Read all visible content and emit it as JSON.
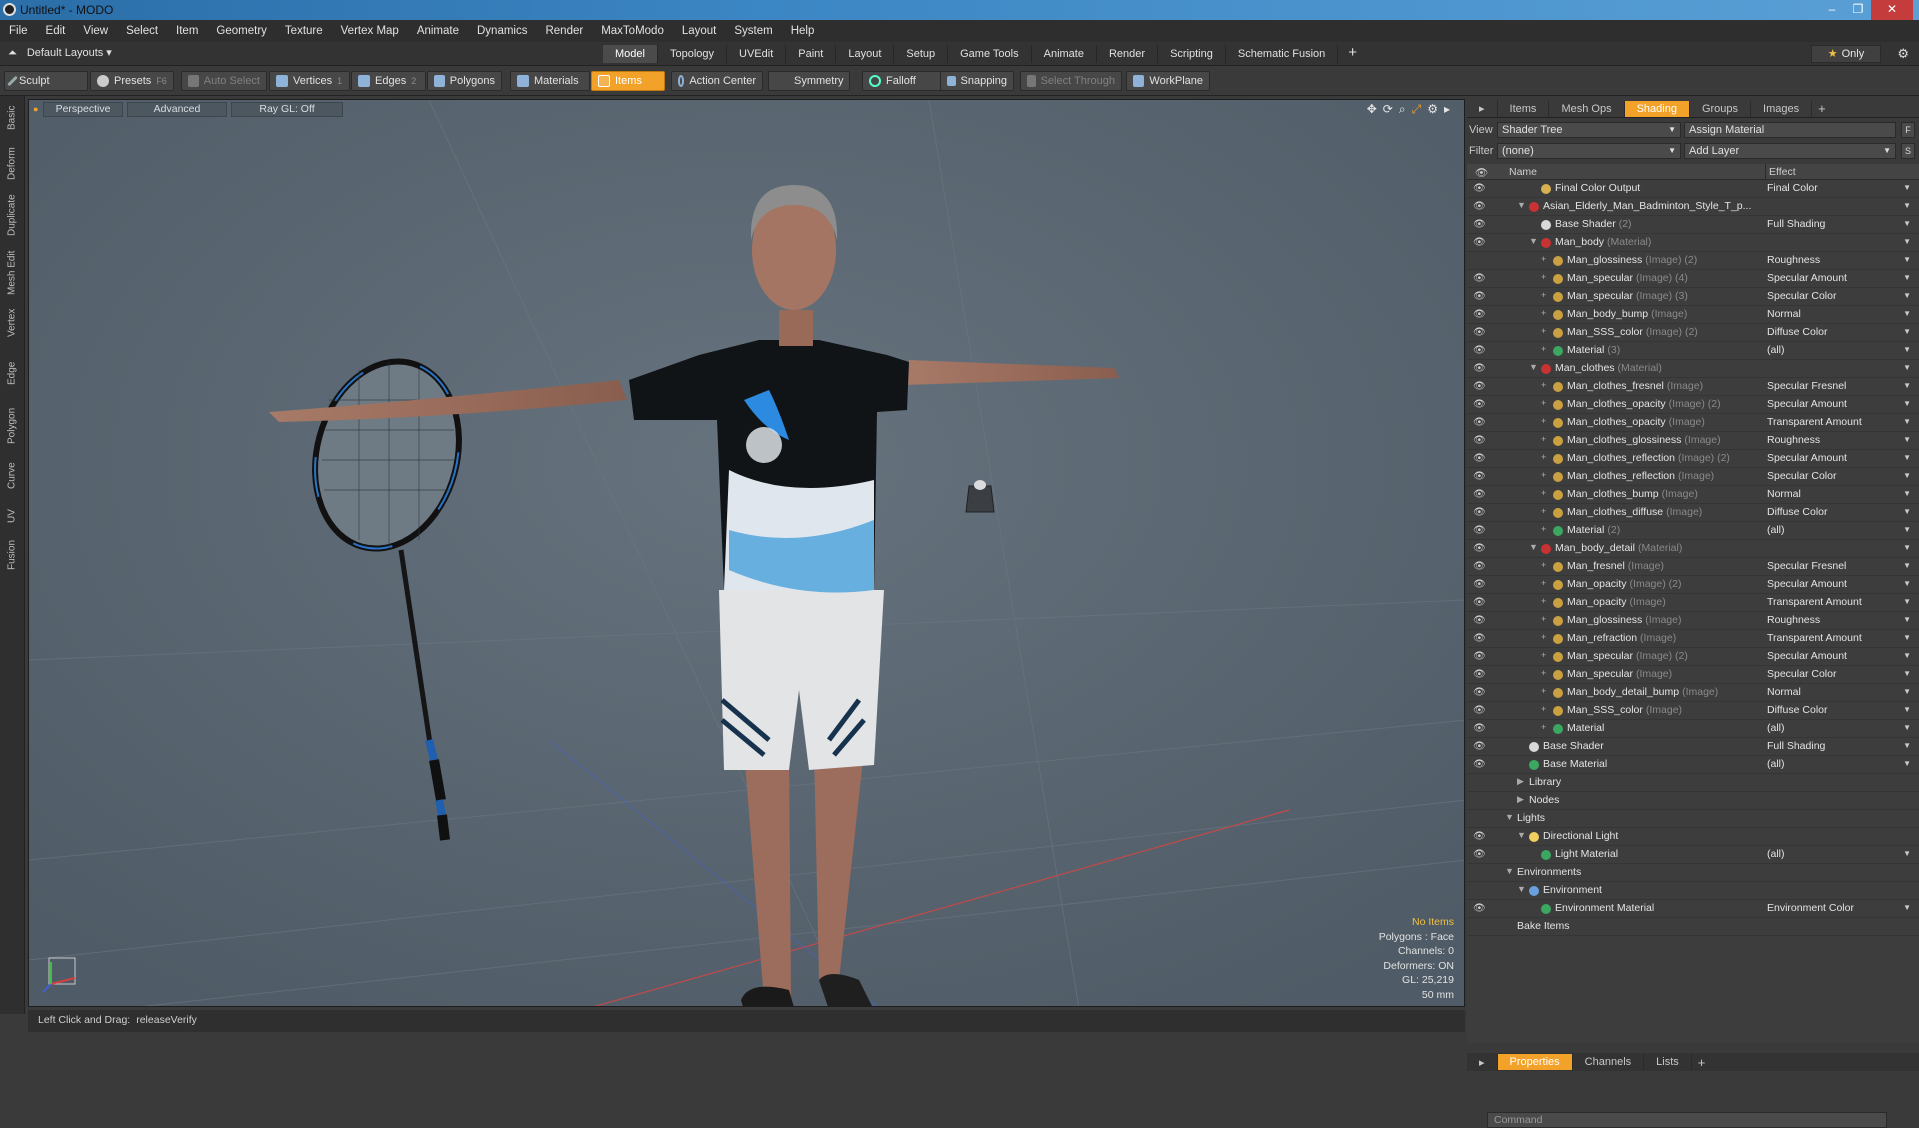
{
  "window": {
    "title": "Untitled* - MODO"
  },
  "menu": [
    "File",
    "Edit",
    "View",
    "Select",
    "Item",
    "Geometry",
    "Texture",
    "Vertex Map",
    "Animate",
    "Dynamics",
    "Render",
    "MaxToModo",
    "Layout",
    "System",
    "Help"
  ],
  "layout": {
    "current": "Default Layouts",
    "tabs": [
      "Model",
      "Topology",
      "UVEdit",
      "Paint",
      "Layout",
      "Setup",
      "Game Tools",
      "Animate",
      "Render",
      "Scripting",
      "Schematic Fusion"
    ],
    "active_tab": "Model",
    "only_label": "Only"
  },
  "toolbar": {
    "sculpt": "Sculpt",
    "presets": "Presets",
    "presets_key": "F6",
    "auto_select": "Auto Select",
    "vertices": "Vertices",
    "vertices_key": "1",
    "edges": "Edges",
    "edges_key": "2",
    "polygons": "Polygons",
    "materials": "Materials",
    "items": "Items",
    "action_center": "Action Center",
    "symmetry": "Symmetry",
    "falloff": "Falloff",
    "snapping": "Snapping",
    "select_through": "Select Through",
    "workplane": "WorkPlane"
  },
  "side_tabs": [
    "Basic",
    "Deform",
    "Duplicate",
    "Mesh Edit",
    "Vertex",
    "Edge",
    "Polygon",
    "Curve",
    "UV",
    "Fusion"
  ],
  "viewport": {
    "view": "Perspective",
    "shading": "Advanced",
    "raygl": "Ray GL: Off",
    "info": {
      "selection": "No Items",
      "polygons": "Polygons : Face",
      "channels": "Channels: 0",
      "deformers": "Deformers: ON",
      "gl": "GL: 25,219",
      "focal": "50 mm"
    }
  },
  "status": {
    "label": "Left Click and Drag:",
    "value": "releaseVerify"
  },
  "right_panel": {
    "tabs": [
      "Items",
      "Mesh Ops",
      "Shading",
      "Groups",
      "Images"
    ],
    "active_tab": "Shading",
    "view_label": "View",
    "view_value": "Shader Tree",
    "assign": "Assign Material",
    "filter_label": "Filter",
    "filter_value": "(none)",
    "add_layer": "Add Layer",
    "col_name": "Name",
    "col_effect": "Effect",
    "tree": [
      {
        "depth": 2,
        "name": "Final Color Output",
        "type": "",
        "effect": "Final Color",
        "icon": "output",
        "eye": true
      },
      {
        "depth": 1,
        "exp": "▼",
        "name": "Asian_Elderly_Man_Badminton_Style_T_p...",
        "type": "",
        "effect": "",
        "icon": "red",
        "eye": true
      },
      {
        "depth": 2,
        "name": "Base Shader",
        "type": "(2)",
        "effect": "Full Shading",
        "icon": "white",
        "eye": true
      },
      {
        "depth": 2,
        "exp": "▼",
        "name": "Man_body",
        "type": "(Material)",
        "effect": "",
        "icon": "red",
        "eye": true
      },
      {
        "depth": 3,
        "name": "Man_glossiness",
        "type": "(Image) (2)",
        "effect": "Roughness",
        "icon": "img",
        "eye": false
      },
      {
        "depth": 3,
        "name": "Man_specular",
        "type": "(Image) (4)",
        "effect": "Specular Amount",
        "icon": "img",
        "eye": true
      },
      {
        "depth": 3,
        "name": "Man_specular",
        "type": "(Image) (3)",
        "effect": "Specular Color",
        "icon": "img",
        "eye": true
      },
      {
        "depth": 3,
        "name": "Man_body_bump",
        "type": "(Image)",
        "effect": "Normal",
        "icon": "img",
        "eye": true
      },
      {
        "depth": 3,
        "name": "Man_SSS_color",
        "type": "(Image) (2)",
        "effect": "Diffuse Color",
        "icon": "img",
        "eye": true
      },
      {
        "depth": 3,
        "name": "Material",
        "type": "(3)",
        "effect": "(all)",
        "icon": "green",
        "eye": true
      },
      {
        "depth": 2,
        "exp": "▼",
        "name": "Man_clothes",
        "type": "(Material)",
        "effect": "",
        "icon": "red",
        "eye": true
      },
      {
        "depth": 3,
        "name": "Man_clothes_fresnel",
        "type": "(Image)",
        "effect": "Specular Fresnel",
        "icon": "img",
        "eye": true
      },
      {
        "depth": 3,
        "name": "Man_clothes_opacity",
        "type": "(Image) (2)",
        "effect": "Specular Amount",
        "icon": "img",
        "eye": true
      },
      {
        "depth": 3,
        "name": "Man_clothes_opacity",
        "type": "(Image)",
        "effect": "Transparent Amount",
        "icon": "img",
        "eye": true
      },
      {
        "depth": 3,
        "name": "Man_clothes_glossiness",
        "type": "(Image)",
        "effect": "Roughness",
        "icon": "img",
        "eye": true
      },
      {
        "depth": 3,
        "name": "Man_clothes_reflection",
        "type": "(Image) (2)",
        "effect": "Specular Amount",
        "icon": "img",
        "eye": true
      },
      {
        "depth": 3,
        "name": "Man_clothes_reflection",
        "type": "(Image)",
        "effect": "Specular Color",
        "icon": "img",
        "eye": true
      },
      {
        "depth": 3,
        "name": "Man_clothes_bump",
        "type": "(Image)",
        "effect": "Normal",
        "icon": "img",
        "eye": true
      },
      {
        "depth": 3,
        "name": "Man_clothes_diffuse",
        "type": "(Image)",
        "effect": "Diffuse Color",
        "icon": "img",
        "eye": true
      },
      {
        "depth": 3,
        "name": "Material",
        "type": "(2)",
        "effect": "(all)",
        "icon": "green",
        "eye": true
      },
      {
        "depth": 2,
        "exp": "▼",
        "name": "Man_body_detail",
        "type": "(Material)",
        "effect": "",
        "icon": "red",
        "eye": true
      },
      {
        "depth": 3,
        "name": "Man_fresnel",
        "type": "(Image)",
        "effect": "Specular Fresnel",
        "icon": "img",
        "eye": true
      },
      {
        "depth": 3,
        "name": "Man_opacity",
        "type": "(Image) (2)",
        "effect": "Specular Amount",
        "icon": "img",
        "eye": true
      },
      {
        "depth": 3,
        "name": "Man_opacity",
        "type": "(Image)",
        "effect": "Transparent Amount",
        "icon": "img",
        "eye": true
      },
      {
        "depth": 3,
        "name": "Man_glossiness",
        "type": "(Image)",
        "effect": "Roughness",
        "icon": "img",
        "eye": true
      },
      {
        "depth": 3,
        "name": "Man_refraction",
        "type": "(Image)",
        "effect": "Transparent Amount",
        "icon": "img",
        "eye": true
      },
      {
        "depth": 3,
        "name": "Man_specular",
        "type": "(Image) (2)",
        "effect": "Specular Amount",
        "icon": "img",
        "eye": true
      },
      {
        "depth": 3,
        "name": "Man_specular",
        "type": "(Image)",
        "effect": "Specular Color",
        "icon": "img",
        "eye": true
      },
      {
        "depth": 3,
        "name": "Man_body_detail_bump",
        "type": "(Image)",
        "effect": "Normal",
        "icon": "img",
        "eye": true
      },
      {
        "depth": 3,
        "name": "Man_SSS_color",
        "type": "(Image)",
        "effect": "Diffuse Color",
        "icon": "img",
        "eye": true
      },
      {
        "depth": 3,
        "name": "Material",
        "type": "",
        "effect": "(all)",
        "icon": "green",
        "eye": true
      },
      {
        "depth": 1,
        "name": "Base Shader",
        "type": "",
        "effect": "Full Shading",
        "icon": "white",
        "eye": true
      },
      {
        "depth": 1,
        "name": "Base Material",
        "type": "",
        "effect": "(all)",
        "icon": "green",
        "eye": true
      },
      {
        "depth": 1,
        "exp": "▶",
        "name": "Library",
        "type": "",
        "effect": "",
        "icon": "",
        "eye": false
      },
      {
        "depth": 1,
        "exp": "▶",
        "name": "Nodes",
        "type": "",
        "effect": "",
        "icon": "",
        "eye": false
      },
      {
        "depth": 0,
        "exp": "▼",
        "name": "Lights",
        "type": "",
        "effect": "",
        "icon": "",
        "eye": false
      },
      {
        "depth": 1,
        "exp": "▼",
        "name": "Directional Light",
        "type": "",
        "effect": "",
        "icon": "light",
        "eye": true
      },
      {
        "depth": 2,
        "name": "Light Material",
        "type": "",
        "effect": "(all)",
        "icon": "green",
        "eye": true
      },
      {
        "depth": 0,
        "exp": "▼",
        "name": "Environments",
        "type": "",
        "effect": "",
        "icon": "",
        "eye": false
      },
      {
        "depth": 1,
        "exp": "▼",
        "name": "Environment",
        "type": "",
        "effect": "",
        "icon": "env",
        "eye": false
      },
      {
        "depth": 2,
        "name": "Environment Material",
        "type": "",
        "effect": "Environment Color",
        "icon": "green",
        "eye": true
      },
      {
        "depth": 0,
        "name": "Bake Items",
        "type": "",
        "effect": "",
        "icon": "",
        "eye": false
      }
    ],
    "bottom_tabs": [
      "Properties",
      "Channels",
      "Lists"
    ],
    "bottom_active": "Properties",
    "command_placeholder": "Command"
  },
  "colors": {
    "accent": "#f3a229",
    "viewport_bg": "#5b6873",
    "panel_bg": "#3a3a3a"
  }
}
